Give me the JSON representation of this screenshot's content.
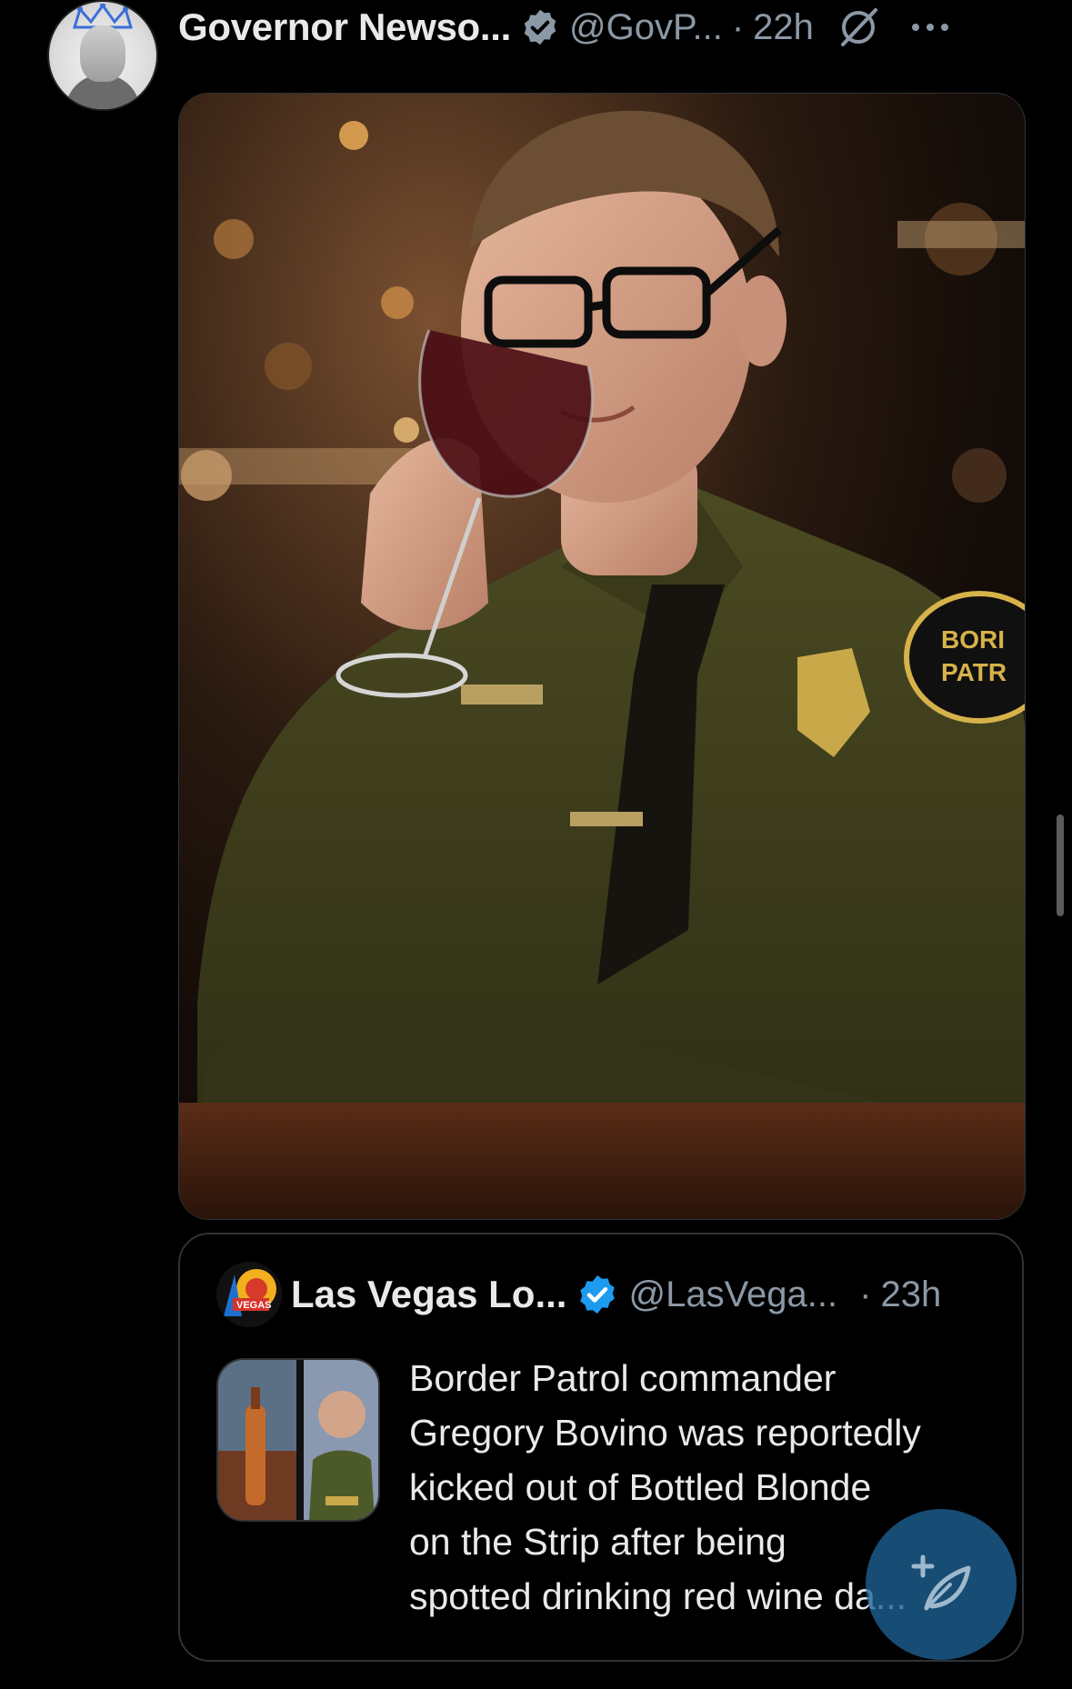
{
  "post": {
    "display_name": "Governor Newso...",
    "handle": "@GovP...",
    "separator": "·",
    "time": "22h",
    "icons": [
      "verified-badge-icon",
      "grok-icon",
      "more-icon"
    ],
    "media": {
      "alt": "Photo of a uniformed officer in a bar sipping red wine from a glass"
    }
  },
  "quote": {
    "display_name": "Las Vegas Lo...",
    "handle": "@LasVega...",
    "separator": "·",
    "time": "23h",
    "text_lines": [
      "Border Patrol commander",
      "Gregory Bovino was reportedly",
      "kicked out of Bottled Blonde",
      "on the Strip after being",
      "spotted drinking red wine da..."
    ]
  },
  "fab": {
    "icon": "compose-post-icon"
  },
  "colors": {
    "background": "#000000",
    "text": "#e7e9ea",
    "muted": "#8b98a5",
    "verified": "#1d9bf0",
    "border": "#2f3336",
    "fab": "#1d6296"
  }
}
